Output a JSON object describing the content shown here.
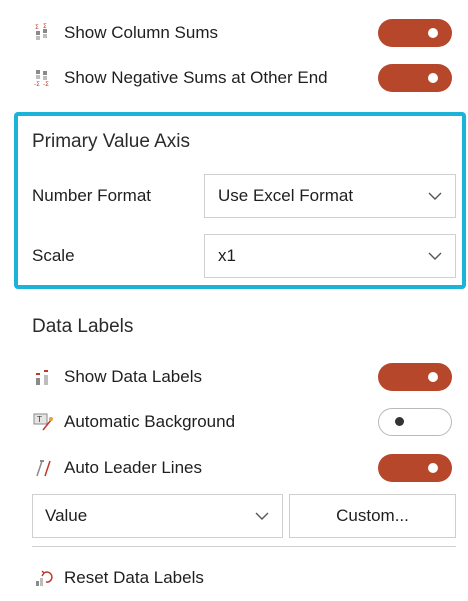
{
  "rows_top": [
    {
      "label": "Show Column Sums",
      "icon": "column-sums-icon",
      "on": true
    },
    {
      "label": "Show Negative Sums at Other End",
      "icon": "negative-sums-icon",
      "on": true
    }
  ],
  "primary_value_axis": {
    "title": "Primary Value Axis",
    "number_format": {
      "label": "Number Format",
      "value": "Use Excel Format"
    },
    "scale": {
      "label": "Scale",
      "value": "x1"
    }
  },
  "data_labels": {
    "title": "Data Labels",
    "rows": [
      {
        "label": "Show Data Labels",
        "icon": "data-labels-icon",
        "on": true
      },
      {
        "label": "Automatic Background",
        "icon": "automatic-background-icon",
        "on": false
      },
      {
        "label": "Auto Leader Lines",
        "icon": "leader-lines-icon",
        "on": true
      }
    ],
    "value_select": "Value",
    "custom_button": "Custom...",
    "reset_label": "Reset Data Labels"
  },
  "colors": {
    "accent": "#b7472a",
    "focus": "#1bb3d8"
  }
}
